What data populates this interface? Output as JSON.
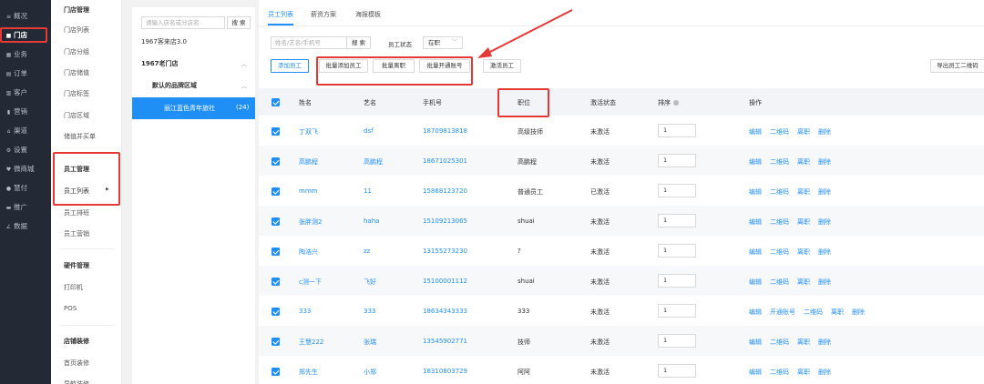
{
  "nav": {
    "items": [
      {
        "icon": "≡",
        "label": "概况"
      },
      {
        "icon": "■",
        "label": "门店"
      },
      {
        "icon": "▦",
        "label": "业务"
      },
      {
        "icon": "▤",
        "label": "订单"
      },
      {
        "icon": "▥",
        "label": "客户"
      },
      {
        "icon": "▮",
        "label": "营销"
      },
      {
        "icon": "⌂",
        "label": "渠道"
      },
      {
        "icon": "⚙",
        "label": "设置"
      },
      {
        "icon": "♥",
        "label": "微商城"
      },
      {
        "icon": "●",
        "label": "慧付"
      },
      {
        "icon": "▬",
        "label": "推广"
      },
      {
        "icon": "∠",
        "label": "数据"
      }
    ]
  },
  "subnav": {
    "group_store": "门店管理",
    "store_items": [
      "门店列表",
      "门店分组",
      "门店储值",
      "门店标签",
      "门店区域",
      "储值并买单"
    ],
    "group_staff": "员工管理",
    "staff_items": [
      "员工列表",
      "员工排班",
      "员工营销"
    ],
    "group_hardware": "硬件管理",
    "hardware_items": [
      "打印机",
      "POS"
    ],
    "group_decor": "店铺装修",
    "decor_items": [
      "首页装修",
      "导航装修"
    ]
  },
  "store_panel": {
    "search_placeholder": "请输入店名或分店名",
    "search_button": "搜 索",
    "brand": "1967客来店3.0",
    "group": "1967老门店",
    "region": "默认的品牌区域",
    "selected_store": "丽江蓝色青年旅社",
    "selected_count": "(24)"
  },
  "main": {
    "tabs": [
      "员工列表",
      "薪资方案",
      "海报模板"
    ],
    "filter": {
      "placeholder": "姓名/艺名/手机号",
      "search_button": "搜 索",
      "status_label": "员工状态",
      "status_value": "在职"
    },
    "actions": [
      "添加员工",
      "批量添加员工",
      "批量离职",
      "批量开通账号",
      "激活员工"
    ],
    "export_button": "导出员工二维码",
    "columns": [
      "姓名",
      "艺名",
      "手机号",
      "职位",
      "激活状态",
      "排序",
      "操作"
    ],
    "rows": [
      {
        "name": "丁双飞",
        "alias": "dsf",
        "phone": "18709813818",
        "position": "高级技师",
        "status": "未激活",
        "sort": "1",
        "ops": [
          "编辑",
          "二维码",
          "离职",
          "删除"
        ]
      },
      {
        "name": "高鹏程",
        "alias": "高鹏程",
        "phone": "18671025301",
        "position": "高鹏程",
        "status": "未激活",
        "sort": "1",
        "ops": [
          "编辑",
          "二维码",
          "离职",
          "删除"
        ]
      },
      {
        "name": "mmm",
        "alias": "11",
        "phone": "15868123720",
        "position": "普通员工",
        "status": "已激活",
        "sort": "1",
        "ops": [
          "编辑",
          "二维码",
          "离职",
          "删除"
        ]
      },
      {
        "name": "张胖测2",
        "alias": "haha",
        "phone": "15109213065",
        "position": "shuai",
        "status": "未激活",
        "sort": "1",
        "ops": [
          "编辑",
          "二维码",
          "离职",
          "删除"
        ]
      },
      {
        "name": "陶浩兴",
        "alias": "zz",
        "phone": "13155273230",
        "position": "?",
        "status": "未激活",
        "sort": "1",
        "ops": [
          "编辑",
          "二维码",
          "离职",
          "删除"
        ]
      },
      {
        "name": "c测一下",
        "alias": "飞好",
        "phone": "15100001112",
        "position": "shuai",
        "status": "未激活",
        "sort": "1",
        "ops": [
          "编辑",
          "二维码",
          "离职",
          "删除"
        ]
      },
      {
        "name": "333",
        "alias": "333",
        "phone": "18634343333",
        "position": "333",
        "status": "未激活",
        "sort": "1",
        "ops": [
          "编辑",
          "开通账号",
          "二维码",
          "离职",
          "删除"
        ]
      },
      {
        "name": "王慧222",
        "alias": "张瑞",
        "phone": "13545902771",
        "position": "技师",
        "status": "未激活",
        "sort": "1",
        "ops": [
          "编辑",
          "二维码",
          "离职",
          "删除"
        ]
      },
      {
        "name": "郑先生",
        "alias": "小郑",
        "phone": "18310803729",
        "position": "阿阿",
        "status": "未激活",
        "sort": "1",
        "ops": [
          "编辑",
          "二维码",
          "离职",
          "删除"
        ]
      }
    ]
  },
  "colors": {
    "accent": "#1f8ff5",
    "annotation": "#e53935",
    "nav_bg": "#232a35"
  }
}
